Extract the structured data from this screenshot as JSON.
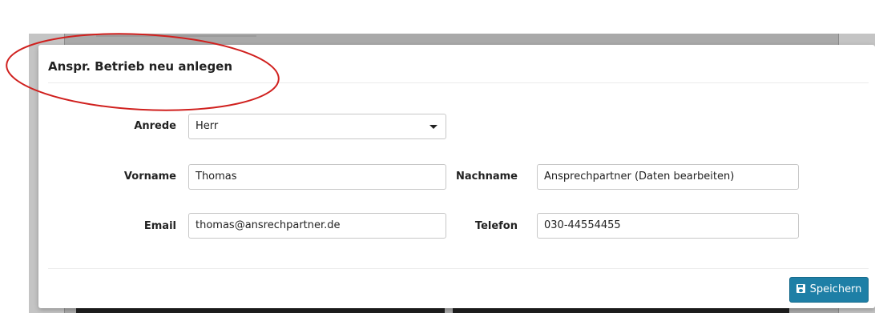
{
  "modal": {
    "title": "Anspr. Betrieb neu anlegen",
    "save_label": "Speichern"
  },
  "form": {
    "anrede": {
      "label": "Anrede",
      "value": "Herr"
    },
    "vorname": {
      "label": "Vorname",
      "value": "Thomas"
    },
    "nachname": {
      "label": "Nachname",
      "value": "Ansprechpartner (Daten bearbeiten)"
    },
    "email": {
      "label": "Email",
      "value": "thomas@ansrechpartner.de"
    },
    "telefon": {
      "label": "Telefon",
      "value": "030-44554455"
    }
  },
  "colors": {
    "primary_button": "#1e7fa6",
    "annotation_ellipse": "#d0201e"
  }
}
